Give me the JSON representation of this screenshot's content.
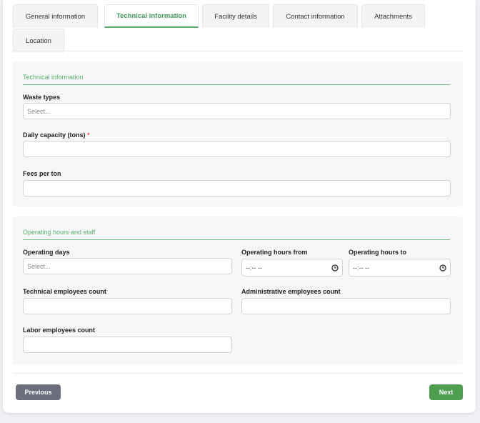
{
  "tabs": [
    {
      "label": "General information"
    },
    {
      "label": "Technical information"
    },
    {
      "label": "Facility details"
    },
    {
      "label": "Contact information"
    },
    {
      "label": "Attachments"
    },
    {
      "label": "Location"
    }
  ],
  "active_tab": "Technical information",
  "technical": {
    "title": "Technical information",
    "waste_types": {
      "label": "Waste types",
      "placeholder": "Select..."
    },
    "daily_capacity": {
      "label": "Daily capacity (tons)",
      "required_mark": "*",
      "value": ""
    },
    "fees_per_ton": {
      "label": "Fees per ton",
      "value": ""
    }
  },
  "operating": {
    "title": "Operating hours and staff",
    "operating_days": {
      "label": "Operating days",
      "placeholder": "Select..."
    },
    "hours_from": {
      "label": "Operating hours from",
      "value": "--:-- --"
    },
    "hours_to": {
      "label": "Operating hours to",
      "value": "--:-- --"
    },
    "technical_employees": {
      "label": "Technical employees count",
      "value": ""
    },
    "administrative_employees": {
      "label": "Administrative employees count",
      "value": ""
    },
    "labor_employees": {
      "label": "Labor employees count",
      "value": ""
    }
  },
  "buttons": {
    "previous": "Previous",
    "next": "Next"
  },
  "colors": {
    "accent": "#5aae6b",
    "next_button": "#4f9d4f",
    "previous_button": "#6b6f7b",
    "required": "#d9534f"
  },
  "icons": {
    "time_field": "clock-icon"
  }
}
